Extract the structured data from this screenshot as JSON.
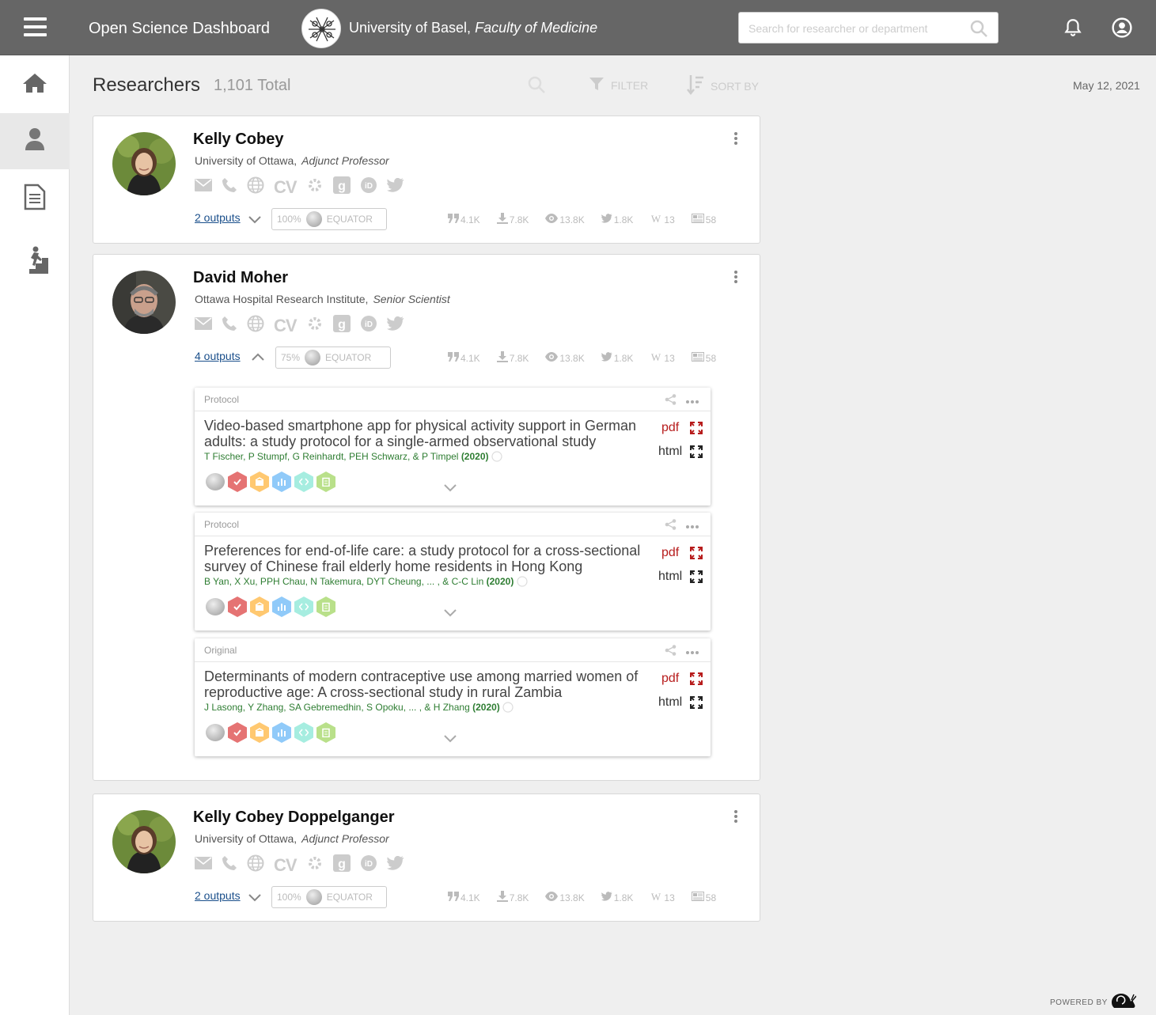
{
  "app": {
    "title": "Open Science Dashboard",
    "institution": "University of Basel,",
    "faculty": "Faculty of Medicine"
  },
  "search": {
    "placeholder": "Search for researcher or department"
  },
  "header": {
    "title": "Researchers",
    "total": "1,101 Total",
    "filter_label": "FILTER",
    "sort_label": "SORT BY",
    "date": "May 12, 2021"
  },
  "researchers": [
    {
      "name": "Kelly Cobey",
      "affiliation": "University of Ottawa,",
      "position": "Adjunct Professor",
      "outputs_label": "2 outputs",
      "equator_pct": "100%",
      "equator_label": "EQUATOR",
      "metrics": {
        "citations": "4.1K",
        "downloads": "7.8K",
        "views": "13.8K",
        "tweets": "1.8K",
        "wiki": "13",
        "news": "58"
      }
    },
    {
      "name": "David Moher",
      "affiliation": "Ottawa Hospital Research Institute,",
      "position": "Senior Scientist",
      "outputs_label": "4 outputs",
      "equator_pct": "75%",
      "equator_label": "EQUATOR",
      "metrics": {
        "citations": "4.1K",
        "downloads": "7.8K",
        "views": "13.8K",
        "tweets": "1.8K",
        "wiki": "13",
        "news": "58"
      },
      "publications": [
        {
          "type": "Protocol",
          "title": "Video-based smartphone app for physical activity support in German adults: a study protocol for a single-armed observational study",
          "authors": "T Fischer, P Stumpf, G Reinhardt, PEH Schwarz, & P Timpel",
          "year": "(2020)",
          "pdf_label": "pdf",
          "html_label": "html"
        },
        {
          "type": "Protocol",
          "title": "Preferences for end-of-life care: a study protocol for a cross-sectional survey of Chinese frail elderly home residents in Hong Kong",
          "authors": "B Yan, X Xu, PPH Chau, N Takemura, DYT Cheung, ... , & C-C Lin",
          "year": "(2020)",
          "pdf_label": "pdf",
          "html_label": "html"
        },
        {
          "type": "Original",
          "title": "Determinants of modern contraceptive use among married women of reproductive age: A cross-sectional study in rural Zambia",
          "authors": "J Lasong, Y Zhang, SA Gebremedhin, S Opoku, ... , & H Zhang",
          "year": "(2020)",
          "pdf_label": "pdf",
          "html_label": "html"
        }
      ]
    },
    {
      "name": "Kelly Cobey Doppelganger",
      "affiliation": "University of Ottawa,",
      "position": "Adjunct Professor",
      "outputs_label": "2 outputs",
      "equator_pct": "100%",
      "equator_label": "EQUATOR",
      "metrics": {
        "citations": "4.1K",
        "downloads": "7.8K",
        "views": "13.8K",
        "tweets": "1.8K",
        "wiki": "13",
        "news": "58"
      }
    }
  ],
  "contact_cv_label": "CV",
  "footer": {
    "powered_by": "POWERED BY"
  },
  "icons": {
    "nav": [
      "home-icon",
      "person-icon",
      "document-icon",
      "stairs-icon"
    ],
    "contacts": [
      "email-icon",
      "phone-icon",
      "globe-icon",
      "cv-icon",
      "gear-icon",
      "google-scholar-icon",
      "orcid-icon",
      "twitter-icon"
    ]
  },
  "colors": {
    "topbar": "#666666",
    "link": "#1a4f8b",
    "pdf": "#b71c1c",
    "authors": "#2e7d32"
  }
}
